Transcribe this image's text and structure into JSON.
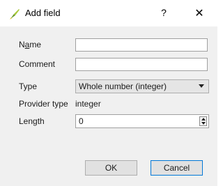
{
  "window": {
    "title": "Add field",
    "icon": "qgis-brush-icon",
    "help_label": "?",
    "close_label": "✕"
  },
  "form": {
    "name": {
      "label_first": "N",
      "label_mnemonic": "a",
      "label_rest": "me",
      "value": ""
    },
    "comment": {
      "label": "Comment",
      "value": ""
    },
    "type": {
      "label": "Type",
      "value": "Whole number (integer)"
    },
    "provider_type": {
      "label": "Provider type",
      "value": "integer"
    },
    "length": {
      "label": "Length",
      "value": "0"
    }
  },
  "buttons": {
    "ok": "OK",
    "cancel": "Cancel"
  },
  "colors": {
    "accent": "#0078d7",
    "background": "#f0f0f0"
  }
}
